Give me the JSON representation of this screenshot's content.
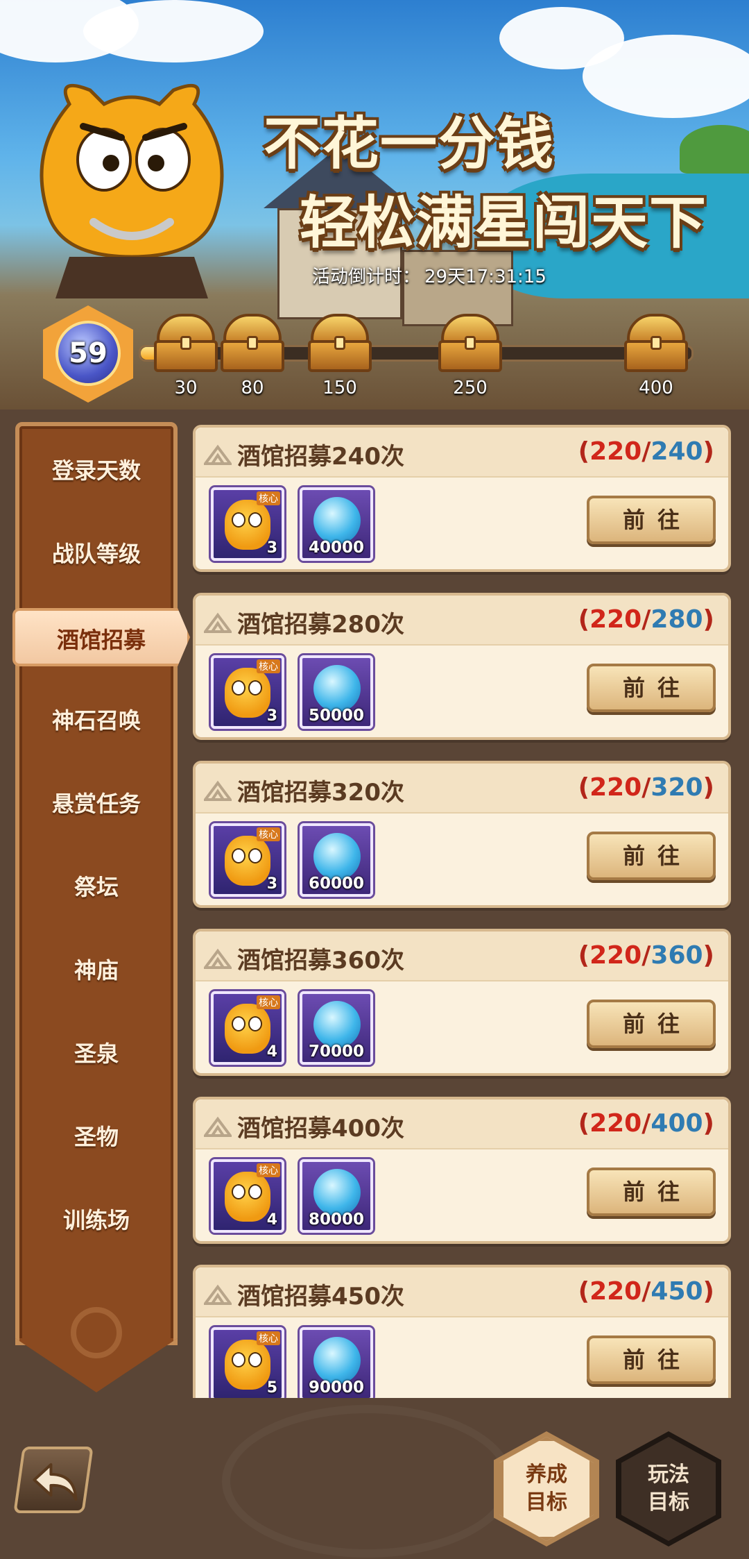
{
  "banner": {
    "title_line1": "不花一分钱",
    "title_line2": "轻松满星闯天下",
    "countdown_label": "活动倒计时：",
    "countdown_value": "29天17:31:15",
    "level": "59",
    "progress_fraction": 0.07,
    "chests": [
      {
        "count": "30",
        "icon": "treasure-chest-open"
      },
      {
        "count": "80",
        "icon": "treasure-chest"
      },
      {
        "count": "150",
        "icon": "treasure-chest"
      },
      {
        "count": "250",
        "icon": "treasure-chest"
      },
      {
        "count": "400",
        "icon": "treasure-chest"
      }
    ]
  },
  "sidebar": {
    "items": [
      {
        "label": "登录天数"
      },
      {
        "label": "战队等级"
      },
      {
        "label": "酒馆招募",
        "active": true
      },
      {
        "label": "神石召唤"
      },
      {
        "label": "悬赏任务"
      },
      {
        "label": "祭坛"
      },
      {
        "label": "神庙"
      },
      {
        "label": "圣泉"
      },
      {
        "label": "圣物"
      },
      {
        "label": "训练场"
      }
    ]
  },
  "tasks": [
    {
      "title": "酒馆招募240次",
      "current": "220",
      "total": "240",
      "hero_qty": "3",
      "gem_qty": "40000",
      "button": "前往"
    },
    {
      "title": "酒馆招募280次",
      "current": "220",
      "total": "280",
      "hero_qty": "3",
      "gem_qty": "50000",
      "button": "前往"
    },
    {
      "title": "酒馆招募320次",
      "current": "220",
      "total": "320",
      "hero_qty": "3",
      "gem_qty": "60000",
      "button": "前往"
    },
    {
      "title": "酒馆招募360次",
      "current": "220",
      "total": "360",
      "hero_qty": "4",
      "gem_qty": "70000",
      "button": "前往"
    },
    {
      "title": "酒馆招募400次",
      "current": "220",
      "total": "400",
      "hero_qty": "4",
      "gem_qty": "80000",
      "button": "前往"
    },
    {
      "title": "酒馆招募450次",
      "current": "220",
      "total": "450",
      "hero_qty": "5",
      "gem_qty": "90000",
      "button": "前往"
    }
  ],
  "reward_tag": "核心",
  "bottom": {
    "cultivate_line1": "养成",
    "cultivate_line2": "目标",
    "play_line1": "玩法",
    "play_line2": "目标"
  },
  "colors": {
    "progress_current": "#d1261a",
    "progress_total": "#2f7bb2",
    "sidebar_bg": "#8b4a20",
    "page_bg": "#5a4536"
  }
}
